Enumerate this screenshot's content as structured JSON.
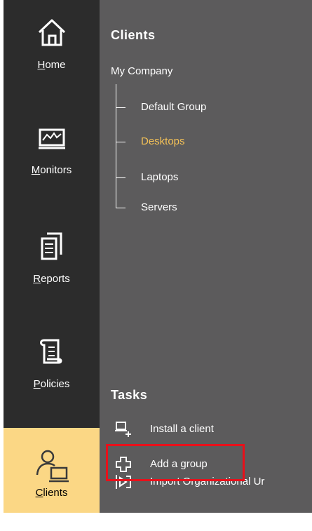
{
  "sidebar": {
    "items": [
      {
        "label": "Home",
        "icon": "home-icon"
      },
      {
        "label": "Monitors",
        "icon": "monitor-chart-icon"
      },
      {
        "label": "Reports",
        "icon": "reports-icon"
      },
      {
        "label": "Policies",
        "icon": "scroll-icon"
      },
      {
        "label": "Clients",
        "icon": "user-computer-icon",
        "active": true
      }
    ]
  },
  "clients": {
    "title": "Clients",
    "root": "My Company",
    "groups": [
      "Default Group",
      "Desktops",
      "Laptops",
      "Servers"
    ],
    "selected_group": "Desktops"
  },
  "tasks": {
    "title": "Tasks",
    "items": [
      {
        "label": "Install a client",
        "icon": "install-client-icon"
      },
      {
        "label": "Add a group",
        "icon": "add-group-icon"
      },
      {
        "label": "Import Organizational Ur",
        "icon": "import-icon"
      }
    ]
  },
  "colors": {
    "sidebar_bg": "#2c2c2c",
    "content_bg": "#5c5b5c",
    "active_nav_bg": "#fbd785",
    "selected_text": "#f5c257",
    "highlight_border": "#e8101a"
  }
}
